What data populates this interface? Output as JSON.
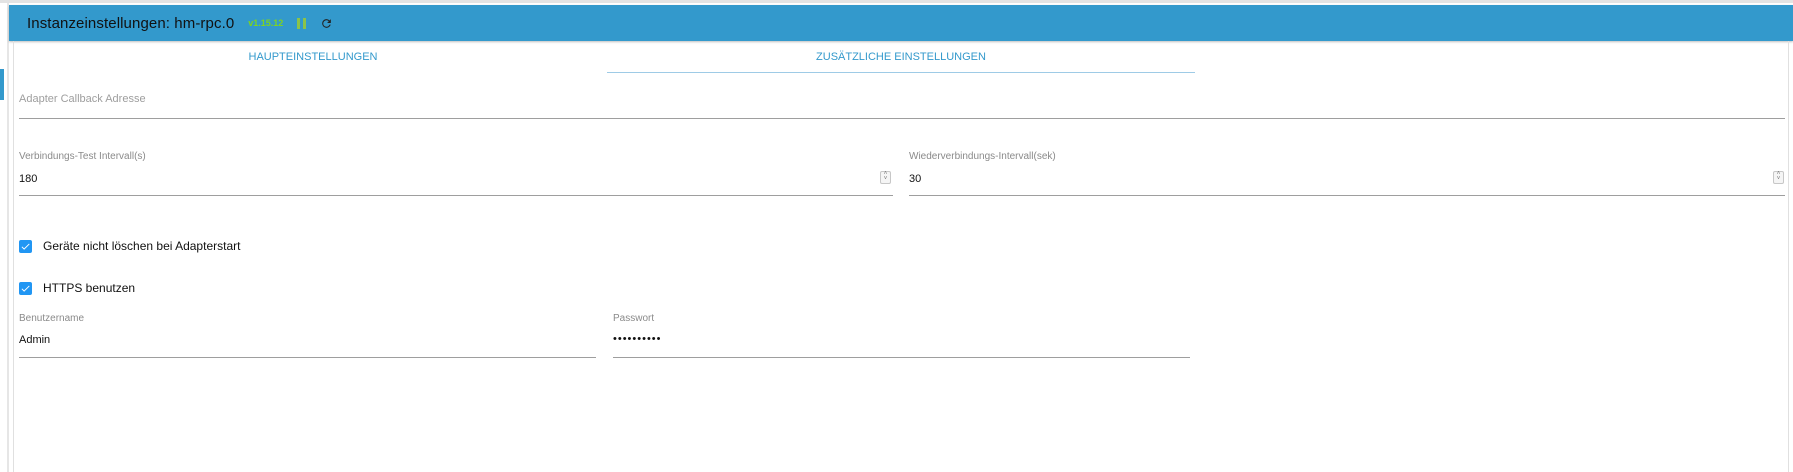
{
  "header": {
    "title": "Instanzeinstellungen: hm-rpc.0",
    "version": "v1.15.12",
    "pause_icon": "pause-icon",
    "reload_icon": "reload-icon",
    "color": "#3399cc"
  },
  "tabs": [
    {
      "label": "HAUPTEINSTELLUNGEN",
      "active": false
    },
    {
      "label": "ZUSÄTZLICHE EINSTELLUNGEN",
      "active": true
    }
  ],
  "fields": {
    "callback": {
      "placeholder": "Adapter Callback Adresse",
      "value": ""
    },
    "test_interval": {
      "label": "Verbindungs-Test Intervall(s)",
      "value": "180"
    },
    "reconnect_interval": {
      "label": "Wiederverbindungs-Intervall(sek)",
      "value": "30"
    },
    "username": {
      "label": "Benutzername",
      "value": "Admin"
    },
    "password": {
      "label": "Passwort",
      "value": "••••••••••"
    }
  },
  "checkboxes": {
    "dont_delete": {
      "label": "Geräte nicht löschen bei Adapterstart",
      "checked": true
    },
    "https": {
      "label": "HTTPS benutzen",
      "checked": true
    }
  },
  "colors": {
    "accent": "#3399cc",
    "checkbox": "#2196f3",
    "version": "#7ed321"
  }
}
